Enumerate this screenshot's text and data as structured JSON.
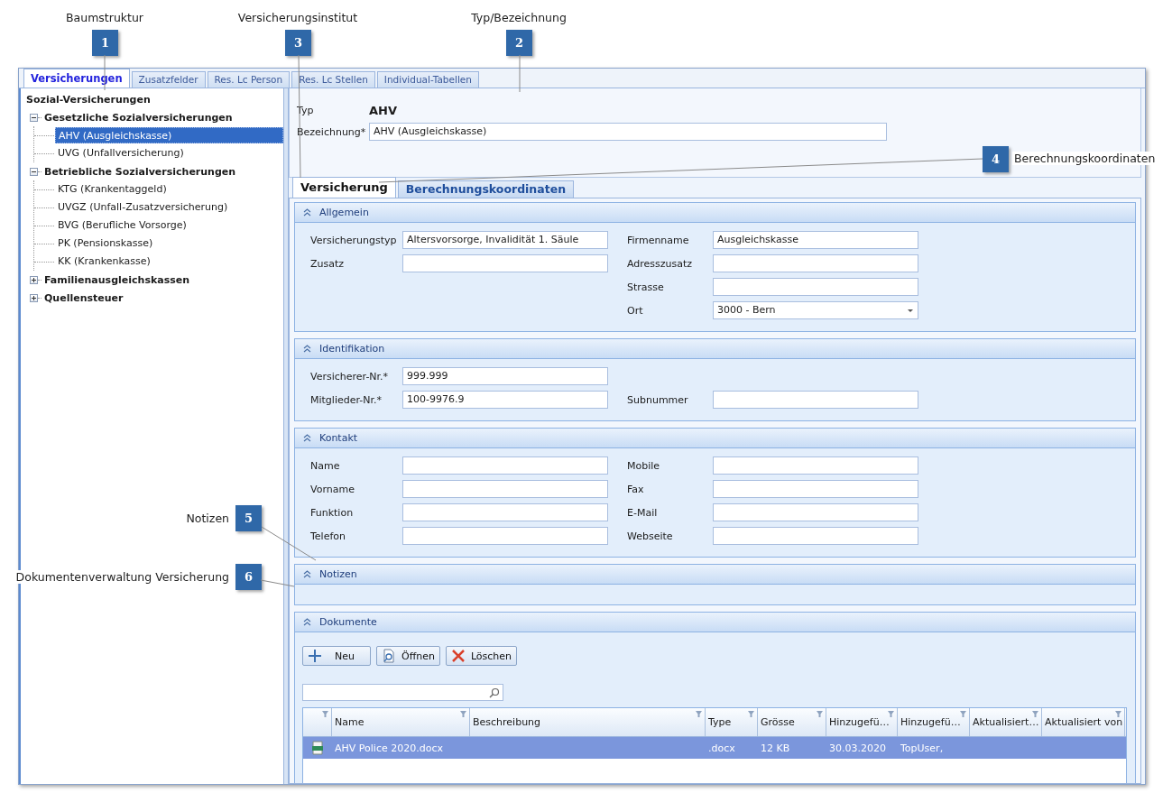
{
  "annotations": [
    {
      "number": "1",
      "label": "Baumstruktur"
    },
    {
      "number": "3",
      "label": "Versicherungsinstitut"
    },
    {
      "number": "2",
      "label": "Typ/Bezeichnung"
    },
    {
      "number": "4",
      "label": "Berechnungskoordinaten"
    },
    {
      "number": "5",
      "label": "Notizen"
    },
    {
      "number": "6",
      "label": "Dokumentenverwaltung Versicherung"
    }
  ],
  "tabs": [
    {
      "label": "Versicherungen",
      "selected": true
    },
    {
      "label": "Zusatzfelder",
      "selected": false
    },
    {
      "label": "Res. Lc Person",
      "selected": false
    },
    {
      "label": "Res. Lc Stellen",
      "selected": false
    },
    {
      "label": "Individual-Tabellen",
      "selected": false
    }
  ],
  "tree": {
    "root": "Sozial-Versicherungen",
    "groups": [
      {
        "label": "Gesetzliche Sozialversicherungen",
        "expanded": true,
        "children": [
          {
            "label": "AHV (Ausgleichskasse)",
            "selected": true
          },
          {
            "label": "UVG (Unfallversicherung)",
            "selected": false
          }
        ]
      },
      {
        "label": "Betriebliche Sozialversicherungen",
        "expanded": true,
        "children": [
          {
            "label": "KTG (Krankentaggeld)",
            "selected": false
          },
          {
            "label": "UVGZ (Unfall-Zusatzversicherung)",
            "selected": false
          },
          {
            "label": "BVG (Berufliche Vorsorge)",
            "selected": false
          },
          {
            "label": "PK (Pensionskasse)",
            "selected": false
          },
          {
            "label": "KK (Krankenkasse)",
            "selected": false
          }
        ]
      },
      {
        "label": "Familienausgleichskassen",
        "expanded": false
      },
      {
        "label": "Quellensteuer",
        "expanded": false
      }
    ]
  },
  "header": {
    "typ_label": "Typ",
    "typ_value": "AHV",
    "name_label": "Bezeichnung*",
    "name_value": "AHV (Ausgleichskasse)"
  },
  "inner_tabs": [
    {
      "label": "Versicherung",
      "selected": true
    },
    {
      "label": "Berechnungskoordinaten",
      "selected": false
    }
  ],
  "sections": [
    {
      "title": "Allgemein",
      "expanded": true,
      "rows": [
        {
          "left": {
            "label": "Versicherungstyp",
            "value": "Altersvorsorge, Invalidität 1. Säule",
            "kind": "text"
          },
          "right": {
            "label": "Firmenname",
            "value": "Ausgleichskasse",
            "kind": "text"
          }
        },
        {
          "left": {
            "label": "Zusatz",
            "kind": "text"
          },
          "right": {
            "label": "Adresszusatz",
            "kind": "text"
          }
        },
        {
          "right": {
            "label": "Strasse",
            "kind": "text"
          }
        },
        {
          "right": {
            "label": "Ort",
            "value": "3000 - Bern",
            "kind": "dropdown"
          }
        }
      ]
    },
    {
      "title": "Identifikation",
      "expanded": true,
      "rows": [
        {
          "left": {
            "label": "Versicherer-Nr.*",
            "value": "999.999",
            "kind": "text"
          }
        },
        {
          "left": {
            "label": "Mitglieder-Nr.*",
            "value": "100-9976.9",
            "kind": "text"
          },
          "right": {
            "label": "Subnummer",
            "kind": "text"
          }
        }
      ]
    },
    {
      "title": "Kontakt",
      "expanded": true,
      "rows": [
        {
          "left": {
            "label": "Name",
            "kind": "text"
          },
          "right": {
            "label": "Mobile",
            "kind": "text"
          }
        },
        {
          "left": {
            "label": "Vorname",
            "kind": "text"
          },
          "right": {
            "label": "Fax",
            "kind": "text"
          }
        },
        {
          "left": {
            "label": "Funktion",
            "kind": "text"
          },
          "right": {
            "label": "E-Mail",
            "kind": "text"
          }
        },
        {
          "left": {
            "label": "Telefon",
            "kind": "text"
          },
          "right": {
            "label": "Webseite",
            "kind": "text"
          }
        }
      ]
    },
    {
      "title": "Notizen",
      "expanded": true
    },
    {
      "title": "Dokumente",
      "expanded": true,
      "kind": "documents"
    }
  ],
  "documents": {
    "buttons": [
      {
        "label": "Neu"
      },
      {
        "label": "Öffnen"
      },
      {
        "label": "Löschen"
      }
    ],
    "columns": [
      {},
      {
        "label": "Name"
      },
      {
        "label": "Beschreibung"
      },
      {
        "label": "Type"
      },
      {
        "label": "Grösse"
      },
      {
        "label": "Hinzugefü…"
      },
      {
        "label": "Hinzugefü…"
      },
      {
        "label": "Aktualisiert…"
      },
      {
        "label": "Aktualisiert von"
      }
    ],
    "rows": [
      {
        "cells": [
          "",
          "AHV Police 2020.docx",
          "",
          ".docx",
          "12 KB",
          "30.03.2020",
          "TopUser,",
          "",
          ""
        ],
        "selected": true
      }
    ]
  }
}
